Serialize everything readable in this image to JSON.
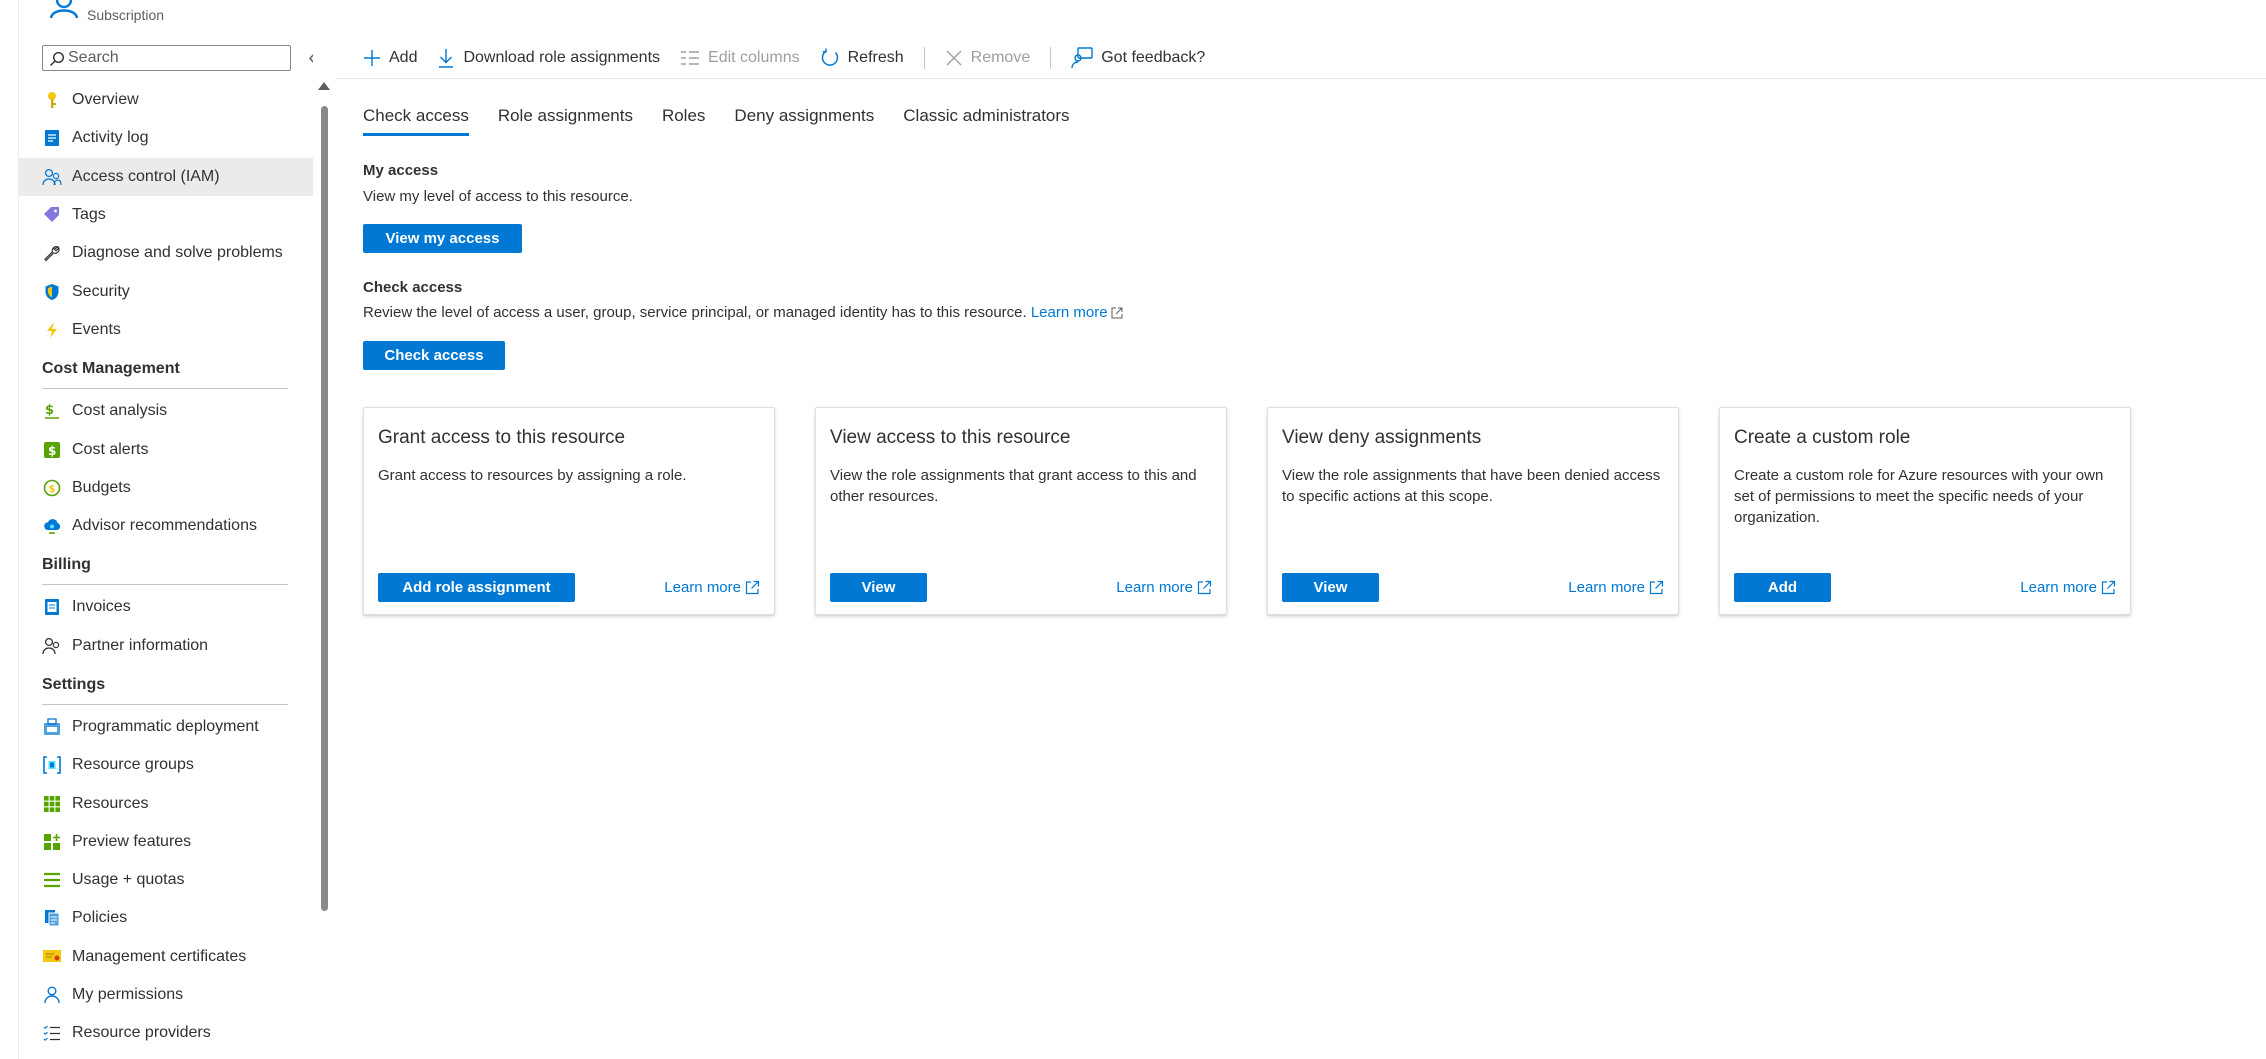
{
  "sidebar": {
    "resource_type": "Subscription",
    "search_placeholder": "Search",
    "collapse_glyph": "«",
    "groups": [
      {
        "items": [
          {
            "label": "Overview",
            "icon": "key-icon"
          },
          {
            "label": "Activity log",
            "icon": "activity-log-icon"
          },
          {
            "label": "Access control (IAM)",
            "icon": "people-icon",
            "selected": true
          },
          {
            "label": "Tags",
            "icon": "tag-icon"
          },
          {
            "label": "Diagnose and solve problems",
            "icon": "wrench-icon"
          },
          {
            "label": "Security",
            "icon": "shield-icon"
          },
          {
            "label": "Events",
            "icon": "lightning-icon"
          }
        ]
      },
      {
        "title": "Cost Management",
        "items": [
          {
            "label": "Cost analysis",
            "icon": "cost-analysis-icon"
          },
          {
            "label": "Cost alerts",
            "icon": "cost-alert-icon"
          },
          {
            "label": "Budgets",
            "icon": "budget-icon"
          },
          {
            "label": "Advisor recommendations",
            "icon": "advisor-icon"
          }
        ]
      },
      {
        "title": "Billing",
        "items": [
          {
            "label": "Invoices",
            "icon": "invoice-icon"
          },
          {
            "label": "Partner information",
            "icon": "partner-icon"
          }
        ]
      },
      {
        "title": "Settings",
        "items": [
          {
            "label": "Programmatic deployment",
            "icon": "deployment-icon"
          },
          {
            "label": "Resource groups",
            "icon": "resource-group-icon"
          },
          {
            "label": "Resources",
            "icon": "resources-grid-icon"
          },
          {
            "label": "Preview features",
            "icon": "preview-icon"
          },
          {
            "label": "Usage + quotas",
            "icon": "usage-icon"
          },
          {
            "label": "Policies",
            "icon": "policy-icon"
          },
          {
            "label": "Management certificates",
            "icon": "certificate-icon"
          },
          {
            "label": "My permissions",
            "icon": "person-icon"
          },
          {
            "label": "Resource providers",
            "icon": "provider-icon"
          }
        ]
      }
    ]
  },
  "toolbar": {
    "add": "Add",
    "download": "Download role assignments",
    "edit_columns": "Edit columns",
    "refresh": "Refresh",
    "remove": "Remove",
    "feedback": "Got feedback?"
  },
  "tabs": [
    "Check access",
    "Role assignments",
    "Roles",
    "Deny assignments",
    "Classic administrators"
  ],
  "my_access": {
    "heading": "My access",
    "description": "View my level of access to this resource.",
    "button": "View my access"
  },
  "check_access": {
    "heading": "Check access",
    "description": "Review the level of access a user, group, service principal, or managed identity has to this resource.",
    "learn_more": "Learn more",
    "button": "Check access"
  },
  "cards": [
    {
      "title": "Grant access to this resource",
      "description": "Grant access to resources by assigning a role.",
      "button": "Add role assignment",
      "link": "Learn more"
    },
    {
      "title": "View access to this resource",
      "description": "View the role assignments that grant access to this and other resources.",
      "button": "View",
      "link": "Learn more"
    },
    {
      "title": "View deny assignments",
      "description": "View the role assignments that have been denied access to specific actions at this scope.",
      "button": "View",
      "link": "Learn more"
    },
    {
      "title": "Create a custom role",
      "description": "Create a custom role for Azure resources with your own set of permissions to meet the specific needs of your organization.",
      "button": "Add",
      "link": "Learn more"
    }
  ],
  "colors": {
    "accent": "#0078d4",
    "selected_bg": "#edebe9",
    "text": "#323130"
  }
}
